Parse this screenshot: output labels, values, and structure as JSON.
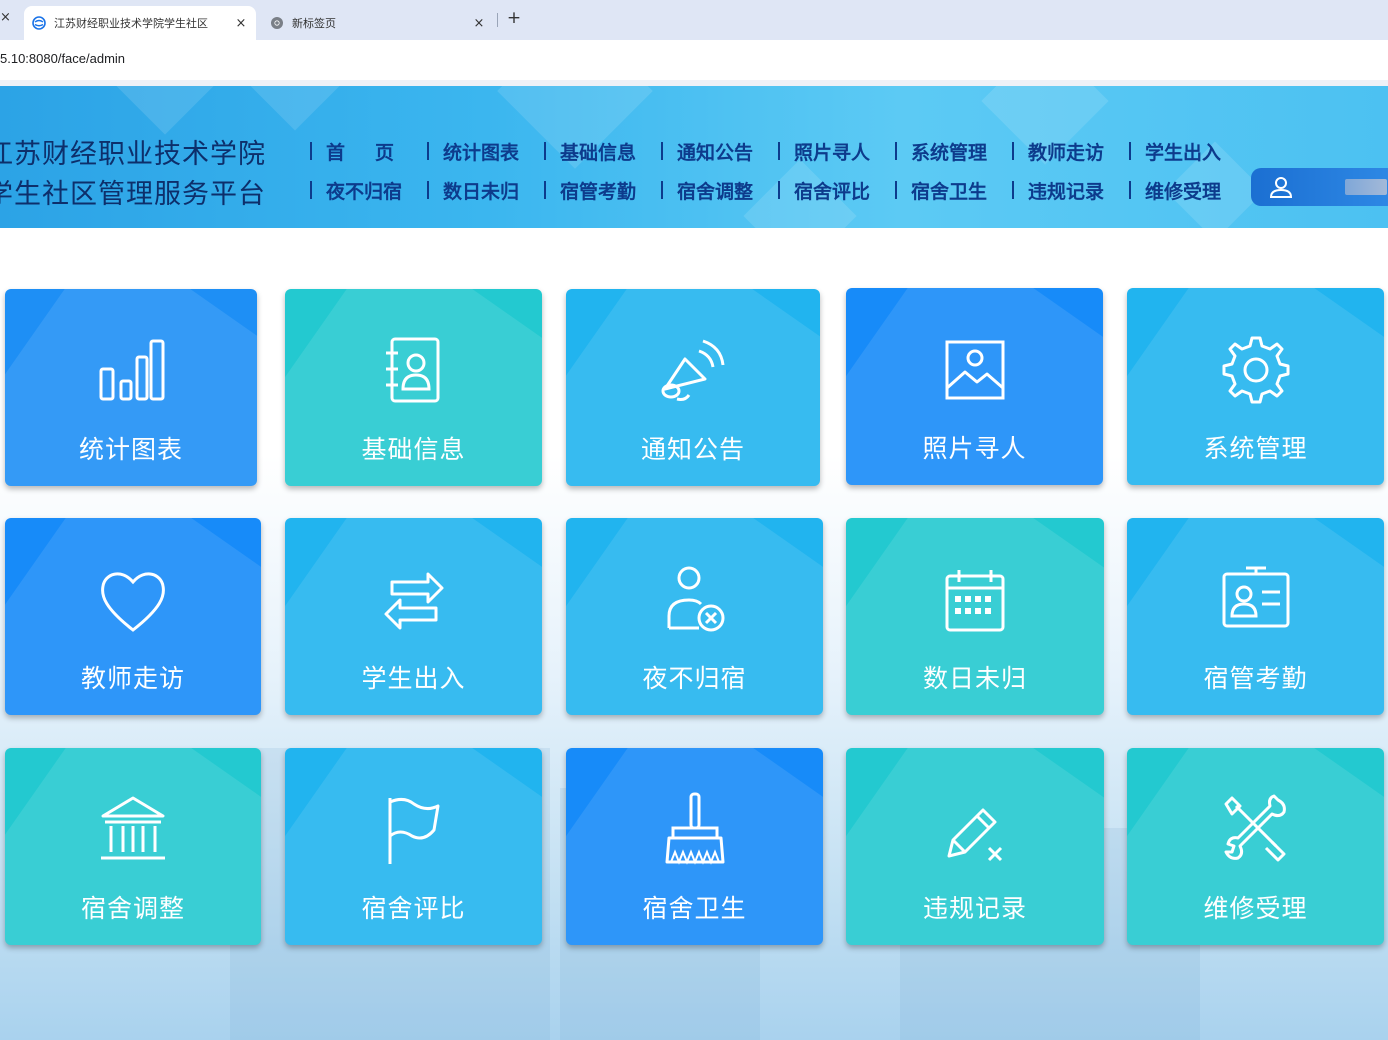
{
  "browser": {
    "tabs": [
      {
        "label": "江苏财经职业技术学院学生社区",
        "active": true
      },
      {
        "label": "新标签页",
        "active": false
      }
    ],
    "new_tab_symbol": "+",
    "close_symbol": "×",
    "address": "5.10:8080/face/admin"
  },
  "header": {
    "school_line1": "江苏财经职业技术学院",
    "school_line2": "学生社区管理服务平台",
    "nav_row1": [
      "首页",
      "统计图表",
      "基础信息",
      "通知公告",
      "照片寻人",
      "系统管理",
      "教师走访",
      "学生出入"
    ],
    "nav_row2": [
      "夜不归宿",
      "数日未归",
      "宿管考勤",
      "宿舍调整",
      "宿舍评比",
      "宿舍卫生",
      "违规记录",
      "维修受理"
    ],
    "user_icon": "user-icon"
  },
  "tiles": [
    {
      "label": "统计图表",
      "icon": "bar-chart-icon",
      "color": "#1e8ff5"
    },
    {
      "label": "基础信息",
      "icon": "contact-book-icon",
      "color": "#23c9d0"
    },
    {
      "label": "通知公告",
      "icon": "megaphone-icon",
      "color": "#21b4ef"
    },
    {
      "label": "照片寻人",
      "icon": "image-icon",
      "color": "#178bf9"
    },
    {
      "label": "系统管理",
      "icon": "gear-icon",
      "color": "#21b4ef"
    },
    {
      "label": "教师走访",
      "icon": "heart-icon",
      "color": "#178bf9"
    },
    {
      "label": "学生出入",
      "icon": "swap-arrows-icon",
      "color": "#21b4ef"
    },
    {
      "label": "夜不归宿",
      "icon": "user-remove-icon",
      "color": "#21b4ef"
    },
    {
      "label": "数日未归",
      "icon": "calendar-icon",
      "color": "#23c9d0"
    },
    {
      "label": "宿管考勤",
      "icon": "id-card-icon",
      "color": "#21b4ef"
    },
    {
      "label": "宿舍调整",
      "icon": "building-icon",
      "color": "#23c9d0"
    },
    {
      "label": "宿舍评比",
      "icon": "flag-icon",
      "color": "#21b4ef"
    },
    {
      "label": "宿舍卫生",
      "icon": "broom-icon",
      "color": "#178bf9"
    },
    {
      "label": "违规记录",
      "icon": "pencil-x-icon",
      "color": "#23c9d0"
    },
    {
      "label": "维修受理",
      "icon": "tools-icon",
      "color": "#23c9d0"
    }
  ]
}
